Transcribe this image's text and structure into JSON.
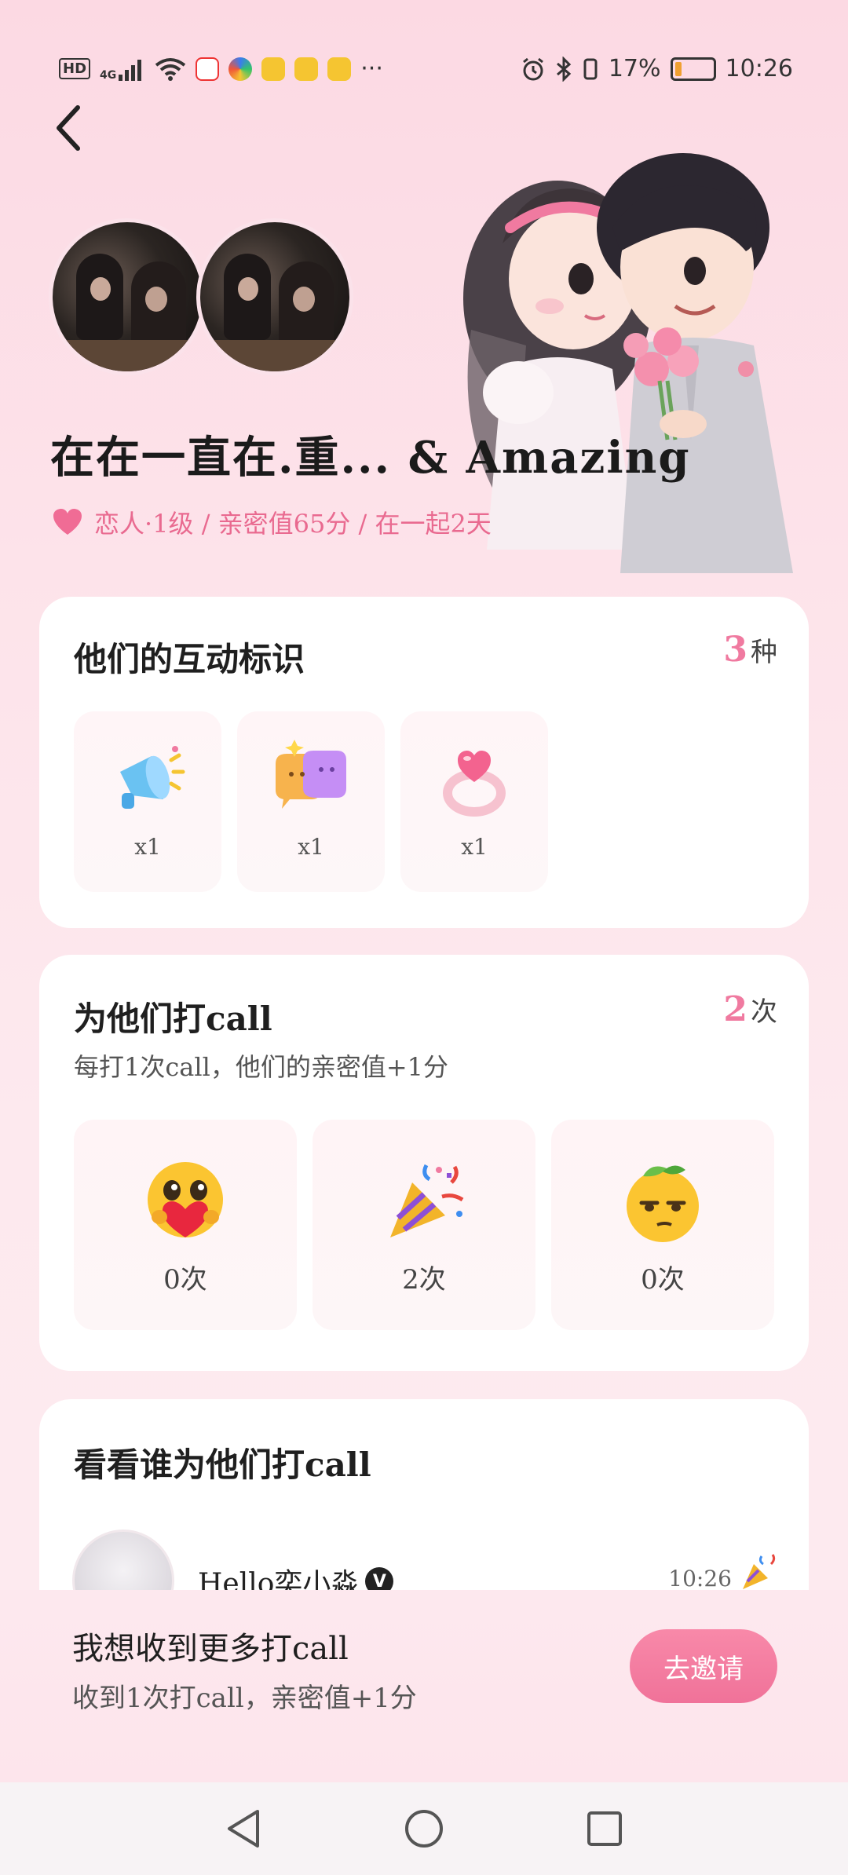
{
  "status_bar": {
    "hd": "HD",
    "network": "4G",
    "battery_text": "17%",
    "battery_level": 0.17,
    "time": "10:26",
    "more": "···"
  },
  "header": {
    "pair_name": "在在一直在.重... & Amazing",
    "relation": "恋人·1级 / 亲密值65分 / 在一起2天"
  },
  "badges_card": {
    "title": "他们的互动标识",
    "count_num": "3",
    "count_unit": "种",
    "items": [
      {
        "icon": "megaphone-icon",
        "count": "x1"
      },
      {
        "icon": "hugging-bubbles-icon",
        "count": "x1"
      },
      {
        "icon": "heart-ring-icon",
        "count": "x1"
      }
    ]
  },
  "call_card": {
    "title": "为他们打call",
    "count_num": "2",
    "count_unit": "次",
    "subtitle": "每打1次call，他们的亲密值+1分",
    "items": [
      {
        "icon": "heart-hug-emoji",
        "count": "0次"
      },
      {
        "icon": "party-popper-emoji",
        "count": "2次"
      },
      {
        "icon": "lemon-face-emoji",
        "count": "0次"
      }
    ]
  },
  "callers_card": {
    "title": "看看谁为他们打call",
    "rows": [
      {
        "name": "Hello奕小淼",
        "verified": "V",
        "time": "10:26",
        "reaction": "party-popper-icon"
      }
    ]
  },
  "invite": {
    "title": "我想收到更多打call",
    "subtitle": "收到1次打call，亲密值+1分",
    "button": "去邀请"
  },
  "colors": {
    "accent": "#f07aa0",
    "background": "#fde3ea",
    "card": "#ffffff"
  }
}
